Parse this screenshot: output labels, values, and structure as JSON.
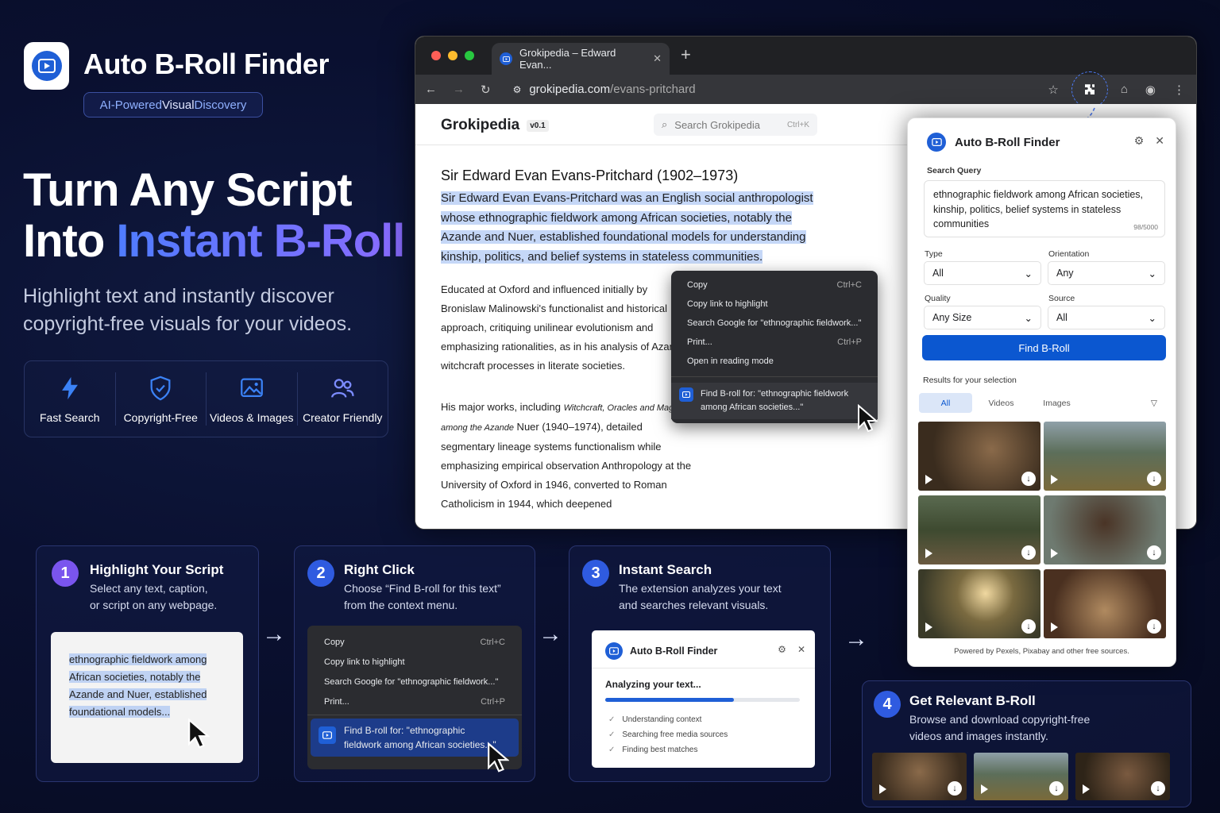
{
  "brand": {
    "title": "Auto B-Roll Finder",
    "tagline_a": "AI-Powered ",
    "tagline_b": "Visual",
    "tagline_c": " Discovery"
  },
  "hero": {
    "line1": "Turn Any Script",
    "line2a": "Into ",
    "line2b": "Instant B-Roll",
    "sub": "Highlight text and instantly discover copyright-free visuals for your videos."
  },
  "features": [
    {
      "label": "Fast Search",
      "icon": "bolt-icon"
    },
    {
      "label": "Copyright-Free",
      "icon": "shield-check-icon"
    },
    {
      "label": "Videos & Images",
      "icon": "image-icon"
    },
    {
      "label": "Creator Friendly",
      "icon": "users-icon"
    }
  ],
  "browser": {
    "tab_title": "Grokipedia – Edward Evan...",
    "url_domain": "grokipedia.com",
    "url_path": "/evans-pritchard"
  },
  "site": {
    "name": "Grokipedia",
    "version": "v0.1",
    "search_placeholder": "Search Grokipedia",
    "search_kbd": "Ctrl+K",
    "article_title": "Sir Edward Evan Evans-Pritchard (1902–1973)",
    "highlight": "Sir Edward Evan Evans-Pritchard was an English social anthropologist whose ethnographic fieldwork among African societies, notably the Azande and Nuer, established foundational models for understanding kinship, politics, and belief systems in stateless communities.",
    "p1": "Educated at Oxford and influenced initially by Bronislaw Malinowski's functionalist and historical approach, critiquing unilinear evolutionism and emphasizing rationalities, as in his analysis of Azande witchcraft processes in literate societies.",
    "p2_a": "His major works, including ",
    "p2_b": "Witchcraft, Oracles and Magic among the Azande",
    "p2_c": " Nuer (1940–1974), detailed segmentary lineage systems functionalism while emphasizing empirical observation Anthropology at the University of Oxford in 1946, converted to Roman Catholicism in 1944, which deepened"
  },
  "context_menu": {
    "copy": "Copy",
    "copy_kbd": "Ctrl+C",
    "copy_link": "Copy link to highlight",
    "search_google": "Search Google for \"ethnographic fieldwork...\"",
    "print": "Print...",
    "print_kbd": "Ctrl+P",
    "reading_mode": "Open in reading mode",
    "find": "Find B-roll for: \"ethnographic fieldwork among African societies...\""
  },
  "panel": {
    "title": "Auto B-Roll Finder",
    "query_label": "Search Query",
    "query": "ethnographic fieldwork among African societies, kinship, politics, belief systems in stateless communities",
    "query_count": "98/5000",
    "type_label": "Type",
    "type_value": "All",
    "orientation_label": "Orientation",
    "orientation_value": "Any",
    "quality_label": "Quality",
    "quality_value": "Any Size",
    "source_label": "Source",
    "source_value": "All",
    "find_button": "Find B-Roll",
    "results_label": "Results for your selection",
    "tabs": [
      "All",
      "Videos",
      "Images"
    ],
    "footer": "Powered by Pexels, Pixabay and other free sources."
  },
  "steps": [
    {
      "num": "1",
      "title": "Highlight Your Script",
      "text1": "Select any text, caption,",
      "text2": "or script on any webpage.",
      "sample": "ethnographic fieldwork among African societies, notably the Azande and Nuer, established foundational models..."
    },
    {
      "num": "2",
      "title": "Right Click",
      "text1": "Choose “Find B-roll for this text”",
      "text2": "from the context menu.",
      "find": "Find B-roll for: \"ethnographic fieldwork among African societies...\""
    },
    {
      "num": "3",
      "title": "Instant Search",
      "text1": "The extension analyzes your text",
      "text2": "and searches relevant visuals.",
      "analyzing": "Analyzing your text...",
      "progress": 0.66,
      "checks": [
        "Understanding context",
        "Searching free media sources",
        "Finding best matches"
      ]
    },
    {
      "num": "4",
      "title": "Get Relevant B-Roll",
      "text1": "Browse and download copyright-free",
      "text2": "videos and images instantly."
    }
  ],
  "colors": {
    "accent": "#0b57d0",
    "brand_blue": "#1f5fd6",
    "purple": "#7a55ee",
    "highlight": "#c5d7f7"
  }
}
